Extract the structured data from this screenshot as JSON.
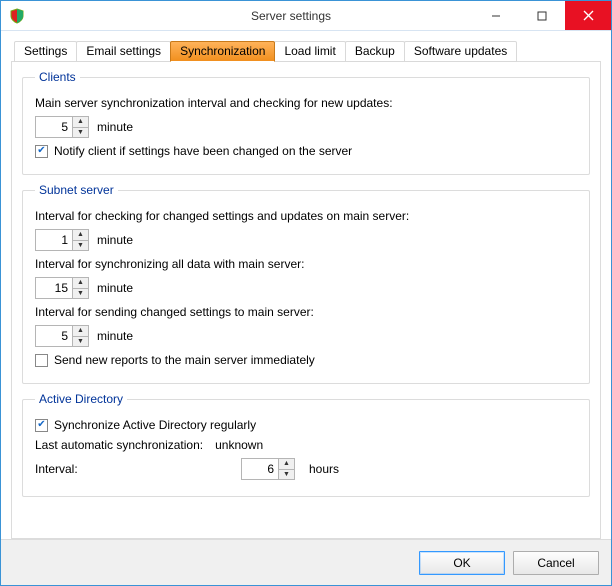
{
  "window": {
    "title": "Server settings"
  },
  "tabs": {
    "settings": "Settings",
    "email": "Email settings",
    "sync": "Synchronization",
    "load": "Load limit",
    "backup": "Backup",
    "updates": "Software updates"
  },
  "clients": {
    "legend": "Clients",
    "mainIntervalLabel": "Main server synchronization interval and checking for new updates:",
    "mainIntervalValue": "5",
    "mainIntervalUnit": "minute",
    "notifyLabel": "Notify client if settings have been changed on the server",
    "notifyChecked": true
  },
  "subnet": {
    "legend": "Subnet server",
    "checkLabel": "Interval for checking for changed settings and updates on main server:",
    "checkValue": "1",
    "checkUnit": "minute",
    "syncAllLabel": "Interval for synchronizing all data with main server:",
    "syncAllValue": "15",
    "syncAllUnit": "minute",
    "sendLabel": "Interval for sending changed settings to main server:",
    "sendValue": "5",
    "sendUnit": "minute",
    "sendImmediateLabel": "Send new reports to the main server immediately",
    "sendImmediateChecked": false
  },
  "ad": {
    "legend": "Active Directory",
    "syncLabel": "Synchronize Active Directory regularly",
    "syncChecked": true,
    "lastLabel": "Last automatic synchronization:",
    "lastValue": "unknown",
    "intervalLabel": "Interval:",
    "intervalValue": "6",
    "intervalUnit": "hours"
  },
  "buttons": {
    "ok": "OK",
    "cancel": "Cancel"
  }
}
